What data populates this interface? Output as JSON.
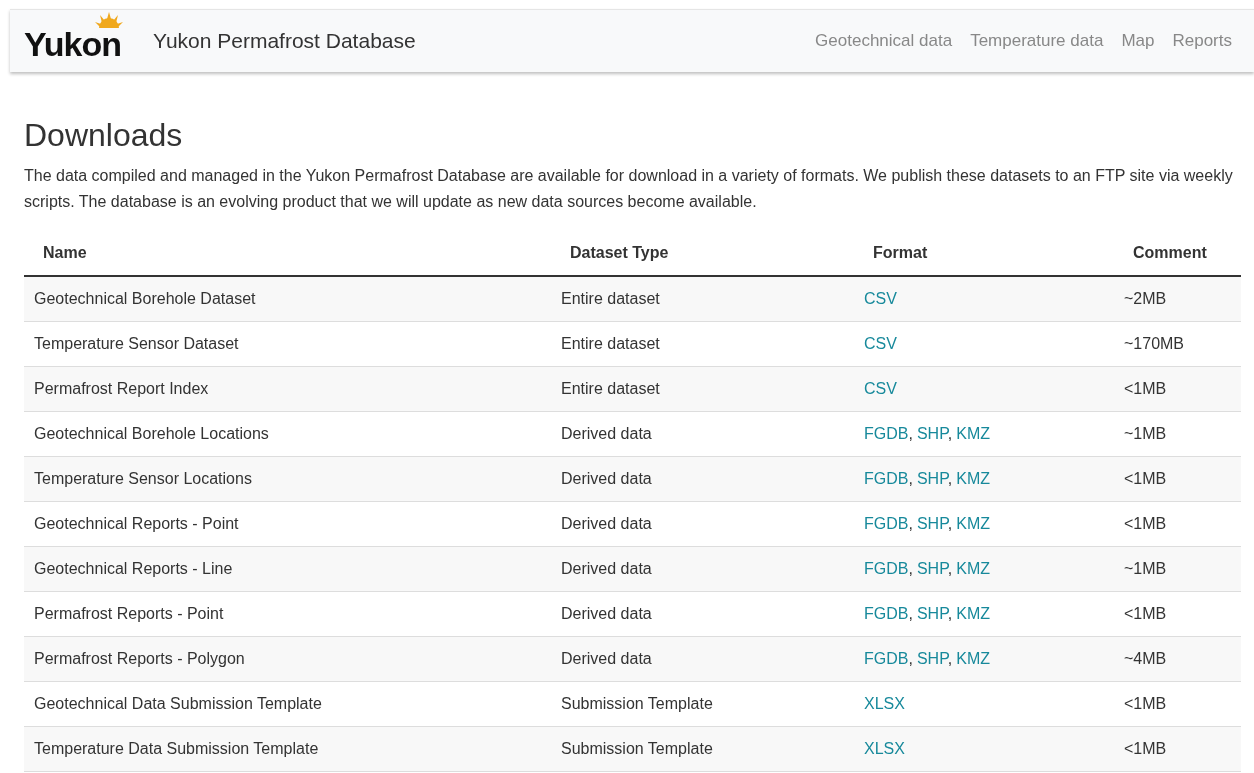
{
  "navbar": {
    "logo": "Yukon",
    "title": "Yukon Permafrost Database",
    "links": [
      "Geotechnical data",
      "Temperature data",
      "Map",
      "Reports"
    ]
  },
  "page": {
    "heading": "Downloads",
    "intro": "The data compiled and managed in the Yukon Permafrost Database are available for download in a variety of formats. We publish these datasets to an FTP site via weekly scripts. The database is an evolving product that we will update as new data sources become available."
  },
  "table": {
    "columns": [
      "Name",
      "Dataset Type",
      "Format",
      "Comment"
    ],
    "format_separator": ",",
    "rows": [
      {
        "name": "Geotechnical Borehole Dataset",
        "type": "Entire dataset",
        "formats": [
          "CSV"
        ],
        "comment": "~2MB"
      },
      {
        "name": "Temperature Sensor Dataset",
        "type": "Entire dataset",
        "formats": [
          "CSV"
        ],
        "comment": "~170MB"
      },
      {
        "name": "Permafrost Report Index",
        "type": "Entire dataset",
        "formats": [
          "CSV"
        ],
        "comment": "<1MB"
      },
      {
        "name": "Geotechnical Borehole Locations",
        "type": "Derived data",
        "formats": [
          "FGDB",
          "SHP",
          "KMZ"
        ],
        "comment": "~1MB"
      },
      {
        "name": "Temperature Sensor Locations",
        "type": "Derived data",
        "formats": [
          "FGDB",
          "SHP",
          "KMZ"
        ],
        "comment": "<1MB"
      },
      {
        "name": "Geotechnical Reports - Point",
        "type": "Derived data",
        "formats": [
          "FGDB",
          "SHP",
          "KMZ"
        ],
        "comment": "<1MB"
      },
      {
        "name": "Geotechnical Reports - Line",
        "type": "Derived data",
        "formats": [
          "FGDB",
          "SHP",
          "KMZ"
        ],
        "comment": "~1MB"
      },
      {
        "name": "Permafrost Reports - Point",
        "type": "Derived data",
        "formats": [
          "FGDB",
          "SHP",
          "KMZ"
        ],
        "comment": "<1MB"
      },
      {
        "name": "Permafrost Reports - Polygon",
        "type": "Derived data",
        "formats": [
          "FGDB",
          "SHP",
          "KMZ"
        ],
        "comment": "~4MB"
      },
      {
        "name": "Geotechnical Data Submission Template",
        "type": "Submission Template",
        "formats": [
          "XLSX"
        ],
        "comment": "<1MB"
      },
      {
        "name": "Temperature Data Submission Template",
        "type": "Submission Template",
        "formats": [
          "XLSX"
        ],
        "comment": "<1MB"
      }
    ]
  }
}
